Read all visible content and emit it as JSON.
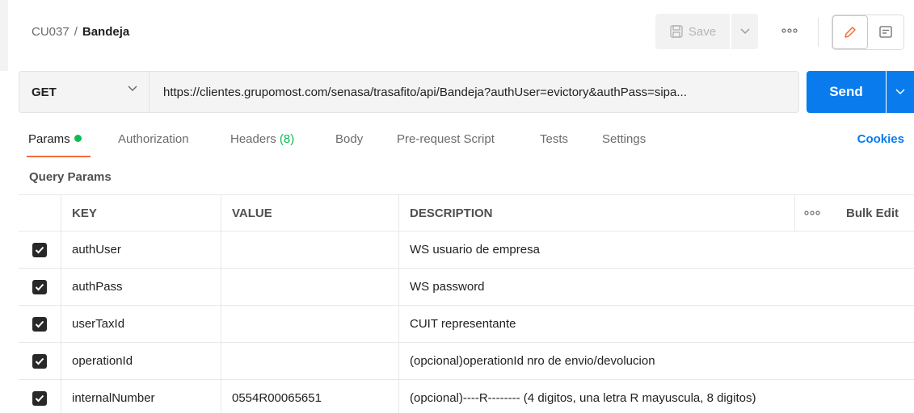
{
  "header": {
    "breadcrumb_parent": "CU037",
    "breadcrumb_separator": "/",
    "breadcrumb_current": "Bandeja",
    "save_label": "Save"
  },
  "request": {
    "method": "GET",
    "url": "https://clientes.grupomost.com/senasa/trasafito/api/Bandeja?authUser=evictory&authPass=sipа...",
    "send_label": "Send"
  },
  "tabs": [
    {
      "label": "Params"
    },
    {
      "label": "Authorization"
    },
    {
      "label": "Headers",
      "count": "(8)"
    },
    {
      "label": "Body"
    },
    {
      "label": "Pre-request Script"
    },
    {
      "label": "Tests"
    },
    {
      "label": "Settings"
    }
  ],
  "cookies_label": "Cookies",
  "query_params": {
    "title": "Query Params",
    "columns": {
      "key": "KEY",
      "value": "VALUE",
      "description": "DESCRIPTION",
      "bulk_edit": "Bulk Edit"
    },
    "rows": [
      {
        "checked": true,
        "key": "authUser",
        "value": "",
        "description": "WS usuario de empresa"
      },
      {
        "checked": true,
        "key": "authPass",
        "value": "",
        "description": "WS password"
      },
      {
        "checked": true,
        "key": "userTaxId",
        "value": "",
        "description": "CUIT representante"
      },
      {
        "checked": true,
        "key": "operationId",
        "value": "",
        "description": "(opcional)operationId nro de envio/devolucion"
      },
      {
        "checked": true,
        "key": "internalNumber",
        "value": "0554R00065651",
        "description": "(opcional)----R-------- (4 digitos, una letra R mayuscula, 8 digitos)"
      }
    ]
  },
  "colors": {
    "accent_blue": "#097bed",
    "tab_underline": "#f26b3a",
    "active_dot": "#0cbb52"
  },
  "icons": [
    "save-icon",
    "chevron-down-icon",
    "more-icon",
    "pencil-icon",
    "comment-icon",
    "checkbox-checked-icon"
  ]
}
